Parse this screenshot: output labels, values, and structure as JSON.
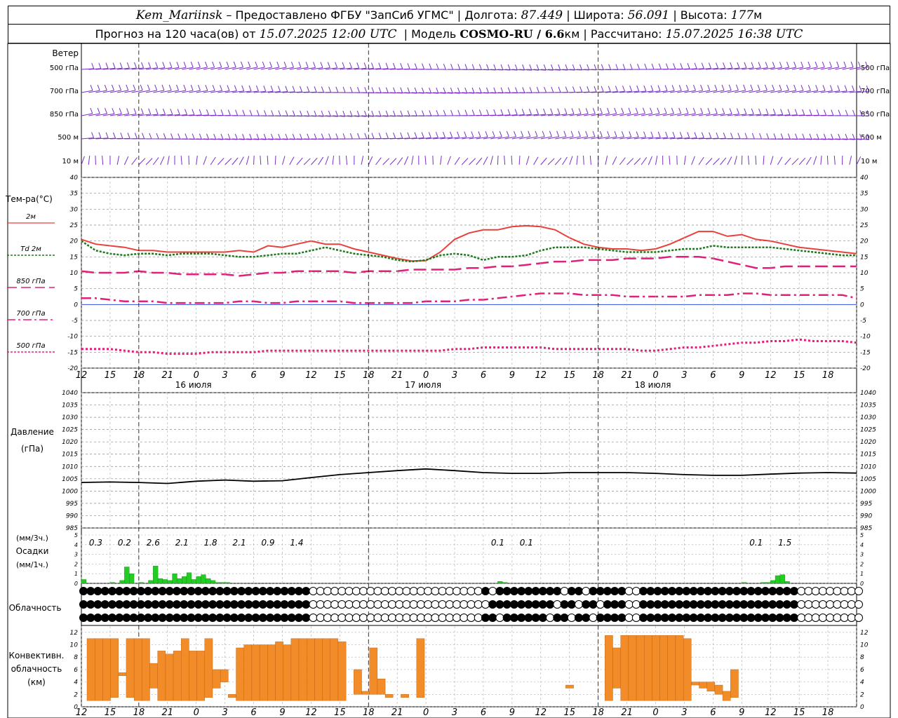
{
  "header": {
    "station": "Kem_Mariinsk",
    "dash": " – ",
    "provider": "Предоставлено ФГБУ \"ЗапСиб УГМС\"",
    "lon_label": "Долгота:",
    "lon": "87.449",
    "lat_label": "Широта:",
    "lat": "56.091",
    "alt_label": "Высота:",
    "alt": "177",
    "alt_unit": "м",
    "forecast_prefix": "Прогноз на 120 часа(ов) от",
    "forecast_start": "15.07.2025 12:00 UTC",
    "model_label": "Модель",
    "model": "COSMO-RU / 6.6",
    "model_unit": "км",
    "computed_label": "Рассчитано:",
    "computed": "15.07.2025 16:38 UTC"
  },
  "wind_panel": {
    "title": "Ветер",
    "levels": [
      "500 гПа",
      "700 гПа",
      "850 гПа",
      "500 м",
      "10  м"
    ]
  },
  "temp_panel": {
    "title": "Тем-ра(°C)",
    "legend": [
      {
        "label": "2м",
        "color": "#e8403a",
        "style": "solid"
      },
      {
        "label": "Td  2м",
        "color": "#1a7a1a",
        "style": "dotted"
      },
      {
        "label": "850 гПа",
        "color": "#e0207a",
        "style": "dashed"
      },
      {
        "label": "700 гПа",
        "color": "#e0207a",
        "style": "dashdot"
      },
      {
        "label": "500 гПа",
        "color": "#e0207a",
        "style": "dotted"
      }
    ],
    "yticks": [
      40,
      35,
      30,
      25,
      20,
      15,
      10,
      5,
      0,
      -5,
      -10,
      -15,
      -20
    ]
  },
  "time_axis": {
    "hour_labels": [
      "12",
      "15",
      "18",
      "21",
      "0",
      "3",
      "6",
      "9",
      "12",
      "15",
      "18",
      "21",
      "0",
      "3",
      "6",
      "9",
      "12",
      "15",
      "18",
      "21",
      "0",
      "3",
      "6",
      "9",
      "12",
      "15",
      "18"
    ],
    "dates": [
      "16 июля",
      "17 июля",
      "18 июля"
    ]
  },
  "pressure_panel": {
    "title": "Давление",
    "unit": "(гПа)",
    "yticks": [
      1040,
      1035,
      1030,
      1025,
      1020,
      1015,
      1010,
      1005,
      1000,
      995,
      990,
      985
    ]
  },
  "precip_panel": {
    "unit3": "(мм/3ч.)",
    "title": "Осадки",
    "unit1": "(мм/1ч.)",
    "yticks": [
      5,
      4,
      3,
      2,
      1,
      0
    ],
    "totals": [
      {
        "t": 3,
        "v": "0.3"
      },
      {
        "t": 9,
        "v": "0.2"
      },
      {
        "t": 15,
        "v": "2.6"
      },
      {
        "t": 21,
        "v": "2.1"
      },
      {
        "t": 27,
        "v": "1.8"
      },
      {
        "t": 33,
        "v": "2.1"
      },
      {
        "t": 39,
        "v": "0.9"
      },
      {
        "t": 45,
        "v": "1.4"
      },
      {
        "t": 87,
        "v": "0.1"
      },
      {
        "t": 93,
        "v": "0.1"
      },
      {
        "t": 141,
        "v": "0.1"
      },
      {
        "t": 147,
        "v": "1.5"
      }
    ],
    "bar_color": "#22cc22"
  },
  "cloud_panel": {
    "title": "Облачность"
  },
  "conv_panel": {
    "title_lines": [
      "Конвективн.",
      "облачность",
      "(км)"
    ],
    "yticks": [
      12,
      10,
      8,
      6,
      4,
      2,
      0
    ],
    "bar_color": "#f28c28"
  },
  "chart_data": [
    {
      "type": "line",
      "title": "Тем-ра(°C)",
      "x_unit": "hours from 15.07.2025 12:00 UTC",
      "ylim": [
        -20,
        40
      ],
      "grid": true,
      "x": [
        0,
        3,
        6,
        9,
        12,
        15,
        18,
        21,
        24,
        27,
        30,
        33,
        36,
        39,
        42,
        45,
        48,
        51,
        54,
        57,
        60,
        63,
        66,
        69,
        72,
        75,
        78,
        81,
        84,
        87,
        90,
        93,
        96,
        99,
        102,
        105,
        108,
        111,
        114,
        117,
        120,
        123,
        126,
        129,
        132,
        135,
        138,
        141,
        144,
        147,
        150,
        153,
        156,
        159,
        162
      ],
      "series": [
        {
          "name": "2м",
          "values": [
            20.5,
            19.0,
            18.5,
            18.0,
            17.0,
            17.0,
            16.5,
            16.5,
            16.5,
            16.5,
            16.5,
            17.0,
            16.5,
            18.5,
            18.0,
            19.0,
            20.0,
            19.0,
            19.0,
            17.5,
            16.5,
            15.5,
            14.5,
            13.7,
            13.8,
            16.5,
            20.5,
            22.5,
            23.5,
            23.5,
            24.5,
            24.8,
            24.5,
            23.5,
            21.0,
            19.0,
            18.0,
            17.5,
            17.5,
            17.0,
            17.5,
            19.0,
            21.0,
            23.0,
            23.0,
            21.5,
            22.0,
            20.5,
            20.0,
            19.0,
            18.0,
            17.5,
            17.0,
            16.5,
            16.0
          ]
        },
        {
          "name": "Td  2м",
          "values": [
            20.0,
            17.0,
            16.0,
            15.5,
            16.0,
            16.0,
            15.5,
            16.0,
            16.0,
            16.0,
            15.5,
            15.0,
            15.0,
            15.5,
            16.0,
            16.0,
            17.0,
            18.0,
            17.0,
            16.0,
            15.5,
            15.0,
            14.0,
            13.5,
            14.0,
            15.5,
            16.0,
            15.5,
            14.0,
            15.0,
            15.0,
            15.5,
            17.0,
            18.0,
            18.0,
            18.0,
            17.5,
            17.0,
            16.5,
            16.5,
            16.5,
            17.0,
            17.5,
            17.5,
            18.5,
            18.0,
            18.0,
            18.0,
            18.0,
            17.5,
            17.0,
            16.5,
            16.0,
            15.5,
            15.5
          ]
        },
        {
          "name": "850 гПа",
          "values": [
            10.5,
            10.0,
            10.0,
            10.0,
            10.5,
            10.0,
            10.0,
            9.5,
            9.5,
            9.5,
            9.5,
            9.0,
            9.5,
            10.0,
            10.0,
            10.5,
            10.5,
            10.5,
            10.5,
            10.0,
            10.5,
            10.5,
            10.5,
            11.0,
            11.0,
            11.0,
            11.0,
            11.5,
            11.5,
            12.0,
            12.0,
            12.5,
            13.0,
            13.5,
            13.5,
            14.0,
            14.0,
            14.0,
            14.5,
            14.5,
            14.5,
            15.0,
            15.0,
            15.0,
            14.5,
            13.5,
            12.5,
            11.5,
            11.5,
            12.0,
            12.0,
            12.0,
            12.0,
            12.0,
            12.0
          ]
        },
        {
          "name": "700 гПа",
          "values": [
            2.0,
            2.0,
            1.5,
            1.0,
            1.0,
            1.0,
            0.5,
            0.5,
            0.5,
            0.5,
            0.5,
            1.0,
            1.0,
            0.5,
            0.5,
            1.0,
            1.0,
            1.0,
            1.0,
            0.5,
            0.5,
            0.5,
            0.5,
            0.5,
            1.0,
            1.0,
            1.0,
            1.5,
            1.5,
            2.0,
            2.5,
            3.0,
            3.5,
            3.5,
            3.5,
            3.0,
            3.0,
            3.0,
            2.5,
            2.5,
            2.5,
            2.5,
            2.5,
            3.0,
            3.0,
            3.0,
            3.5,
            3.5,
            3.0,
            3.0,
            3.0,
            3.0,
            3.0,
            3.0,
            2.0
          ]
        },
        {
          "name": "500 гПа",
          "values": [
            -14.0,
            -14.0,
            -14.0,
            -14.5,
            -15.0,
            -15.0,
            -15.5,
            -15.5,
            -15.5,
            -15.0,
            -15.0,
            -15.0,
            -15.0,
            -14.5,
            -14.5,
            -14.5,
            -14.5,
            -14.5,
            -14.5,
            -14.5,
            -14.5,
            -14.5,
            -14.5,
            -14.5,
            -14.5,
            -14.5,
            -14.0,
            -14.0,
            -13.5,
            -13.5,
            -13.5,
            -13.5,
            -13.5,
            -14.0,
            -14.0,
            -14.0,
            -14.0,
            -14.0,
            -14.0,
            -14.5,
            -14.5,
            -14.0,
            -13.5,
            -13.5,
            -13.0,
            -12.5,
            -12.0,
            -12.0,
            -11.5,
            -11.5,
            -11.0,
            -11.5,
            -11.5,
            -11.5,
            -12.0
          ]
        }
      ]
    },
    {
      "type": "line",
      "title": "Давление",
      "ylabel": "(гПа)",
      "ylim": [
        985,
        1040
      ],
      "grid": true,
      "x": [
        0,
        6,
        12,
        18,
        24,
        30,
        36,
        42,
        48,
        54,
        60,
        66,
        72,
        78,
        84,
        90,
        96,
        102,
        108,
        114,
        120,
        126,
        132,
        138,
        144,
        150,
        156,
        162
      ],
      "series": [
        {
          "name": "Давление",
          "values": [
            1003.5,
            1003.7,
            1003.5,
            1003.1,
            1004.0,
            1004.5,
            1004.0,
            1004.2,
            1005.5,
            1006.7,
            1007.5,
            1008.3,
            1009.0,
            1008.3,
            1007.5,
            1007.2,
            1007.2,
            1007.5,
            1007.5,
            1007.5,
            1007.2,
            1006.7,
            1006.4,
            1006.4,
            1006.9,
            1007.3,
            1007.5,
            1007.3
          ]
        }
      ]
    },
    {
      "type": "bar",
      "title": "Осадки",
      "ylabel": "(мм/1ч.)",
      "ylim": [
        0,
        5
      ],
      "x_unit": "hours",
      "x": [
        0,
        6,
        8,
        9,
        10,
        12,
        14,
        15,
        16,
        17,
        18,
        19,
        20,
        21,
        22,
        23,
        24,
        25,
        26,
        27,
        28,
        29,
        30,
        31,
        32,
        33,
        34,
        35,
        36,
        42,
        43,
        44,
        45,
        46,
        60,
        61,
        62,
        63,
        64,
        65,
        66,
        67,
        68,
        69,
        70,
        71,
        72,
        80,
        81,
        82,
        83,
        84,
        85,
        86,
        87,
        88,
        89,
        90,
        91,
        92,
        132,
        133,
        134,
        138,
        139,
        140,
        141,
        142,
        143,
        144,
        145,
        146,
        147,
        148,
        149,
        150,
        151,
        152,
        153,
        154,
        155
      ],
      "values": [
        0.4,
        0.1,
        0.3,
        1.7,
        1.0,
        0.1,
        0.3,
        1.8,
        0.5,
        0.4,
        0.3,
        1.0,
        0.5,
        0.7,
        1.1,
        0.4,
        0.7,
        0.9,
        0.5,
        0.3,
        0.1,
        0.1,
        0.1,
        0,
        0,
        0,
        0,
        0,
        0,
        0,
        0,
        0,
        0,
        0,
        0,
        0,
        0,
        0,
        0,
        0,
        0,
        0,
        0,
        0,
        0,
        0,
        0,
        0,
        0,
        0,
        0,
        0,
        0,
        0,
        0.2,
        0.1,
        0,
        0,
        0,
        0,
        0,
        0,
        0,
        0.1,
        0,
        0,
        0,
        0.1,
        0.1,
        0.3,
        0.8,
        0.9,
        0.2,
        0,
        0,
        0,
        0,
        0,
        0,
        0,
        0
      ]
    },
    {
      "type": "bar",
      "title": "Конвективн. облачность (км)",
      "ylim": [
        0,
        13
      ],
      "bars": [
        {
          "t": 0,
          "base": 1,
          "top": 11
        },
        {
          "t": 1,
          "base": 1,
          "top": 11
        },
        {
          "t": 2,
          "base": 1,
          "top": 11
        },
        {
          "t": 3,
          "base": 1.5,
          "top": 11
        },
        {
          "t": 4,
          "base": 5,
          "top": 5.5
        },
        {
          "t": 5,
          "base": 1.5,
          "top": 11
        },
        {
          "t": 6,
          "base": 1,
          "top": 11
        },
        {
          "t": 7,
          "base": 1,
          "top": 11
        },
        {
          "t": 8,
          "base": 3,
          "top": 7
        },
        {
          "t": 9,
          "base": 1,
          "top": 9
        },
        {
          "t": 10,
          "base": 1,
          "top": 8.5
        },
        {
          "t": 11,
          "base": 1,
          "top": 9
        },
        {
          "t": 12,
          "base": 1,
          "top": 11
        },
        {
          "t": 13,
          "base": 1,
          "top": 9
        },
        {
          "t": 14,
          "base": 1,
          "top": 9
        },
        {
          "t": 15,
          "base": 1.5,
          "top": 11
        },
        {
          "t": 16,
          "base": 3,
          "top": 6
        },
        {
          "t": 17,
          "base": 4,
          "top": 6
        },
        {
          "t": 18,
          "base": 1.5,
          "top": 2
        },
        {
          "t": 19,
          "base": 1,
          "top": 9.5
        },
        {
          "t": 20,
          "base": 1,
          "top": 10
        },
        {
          "t": 21,
          "base": 1,
          "top": 10
        },
        {
          "t": 22,
          "base": 1,
          "top": 10
        },
        {
          "t": 23,
          "base": 1,
          "top": 10
        },
        {
          "t": 24,
          "base": 1,
          "top": 10.5
        },
        {
          "t": 25,
          "base": 1,
          "top": 10
        },
        {
          "t": 26,
          "base": 1,
          "top": 11
        },
        {
          "t": 27,
          "base": 1,
          "top": 11
        },
        {
          "t": 28,
          "base": 1,
          "top": 11
        },
        {
          "t": 29,
          "base": 1,
          "top": 11
        },
        {
          "t": 30,
          "base": 1,
          "top": 11
        },
        {
          "t": 31,
          "base": 1,
          "top": 11
        },
        {
          "t": 32,
          "base": 1,
          "top": 10.5
        },
        {
          "t": 34,
          "base": 2,
          "top": 6
        },
        {
          "t": 35,
          "base": 2,
          "top": 2.5
        },
        {
          "t": 36,
          "base": 2,
          "top": 9.5
        },
        {
          "t": 37,
          "base": 2,
          "top": 4.5
        },
        {
          "t": 38,
          "base": 1.5,
          "top": 2
        },
        {
          "t": 40,
          "base": 1.5,
          "top": 2
        },
        {
          "t": 42,
          "base": 1.5,
          "top": 11
        },
        {
          "t": 61,
          "base": 3,
          "top": 3.5
        },
        {
          "t": 66,
          "base": 1,
          "top": 11.5
        },
        {
          "t": 67,
          "base": 3,
          "top": 9.5
        },
        {
          "t": 68,
          "base": 1,
          "top": 11.5
        },
        {
          "t": 69,
          "base": 1,
          "top": 11.5
        },
        {
          "t": 70,
          "base": 1,
          "top": 11.5
        },
        {
          "t": 71,
          "base": 1,
          "top": 11.5
        },
        {
          "t": 72,
          "base": 1,
          "top": 11.5
        },
        {
          "t": 73,
          "base": 1,
          "top": 11.5
        },
        {
          "t": 74,
          "base": 1,
          "top": 11.5
        },
        {
          "t": 75,
          "base": 1,
          "top": 11.5
        },
        {
          "t": 76,
          "base": 1,
          "top": 11
        },
        {
          "t": 77,
          "base": 3.5,
          "top": 4
        },
        {
          "t": 78,
          "base": 3,
          "top": 4
        },
        {
          "t": 79,
          "base": 2.5,
          "top": 4
        },
        {
          "t": 80,
          "base": 2,
          "top": 3.5
        },
        {
          "t": 81,
          "base": 1,
          "top": 2.5
        },
        {
          "t": 82,
          "base": 1.5,
          "top": 6
        }
      ]
    }
  ]
}
